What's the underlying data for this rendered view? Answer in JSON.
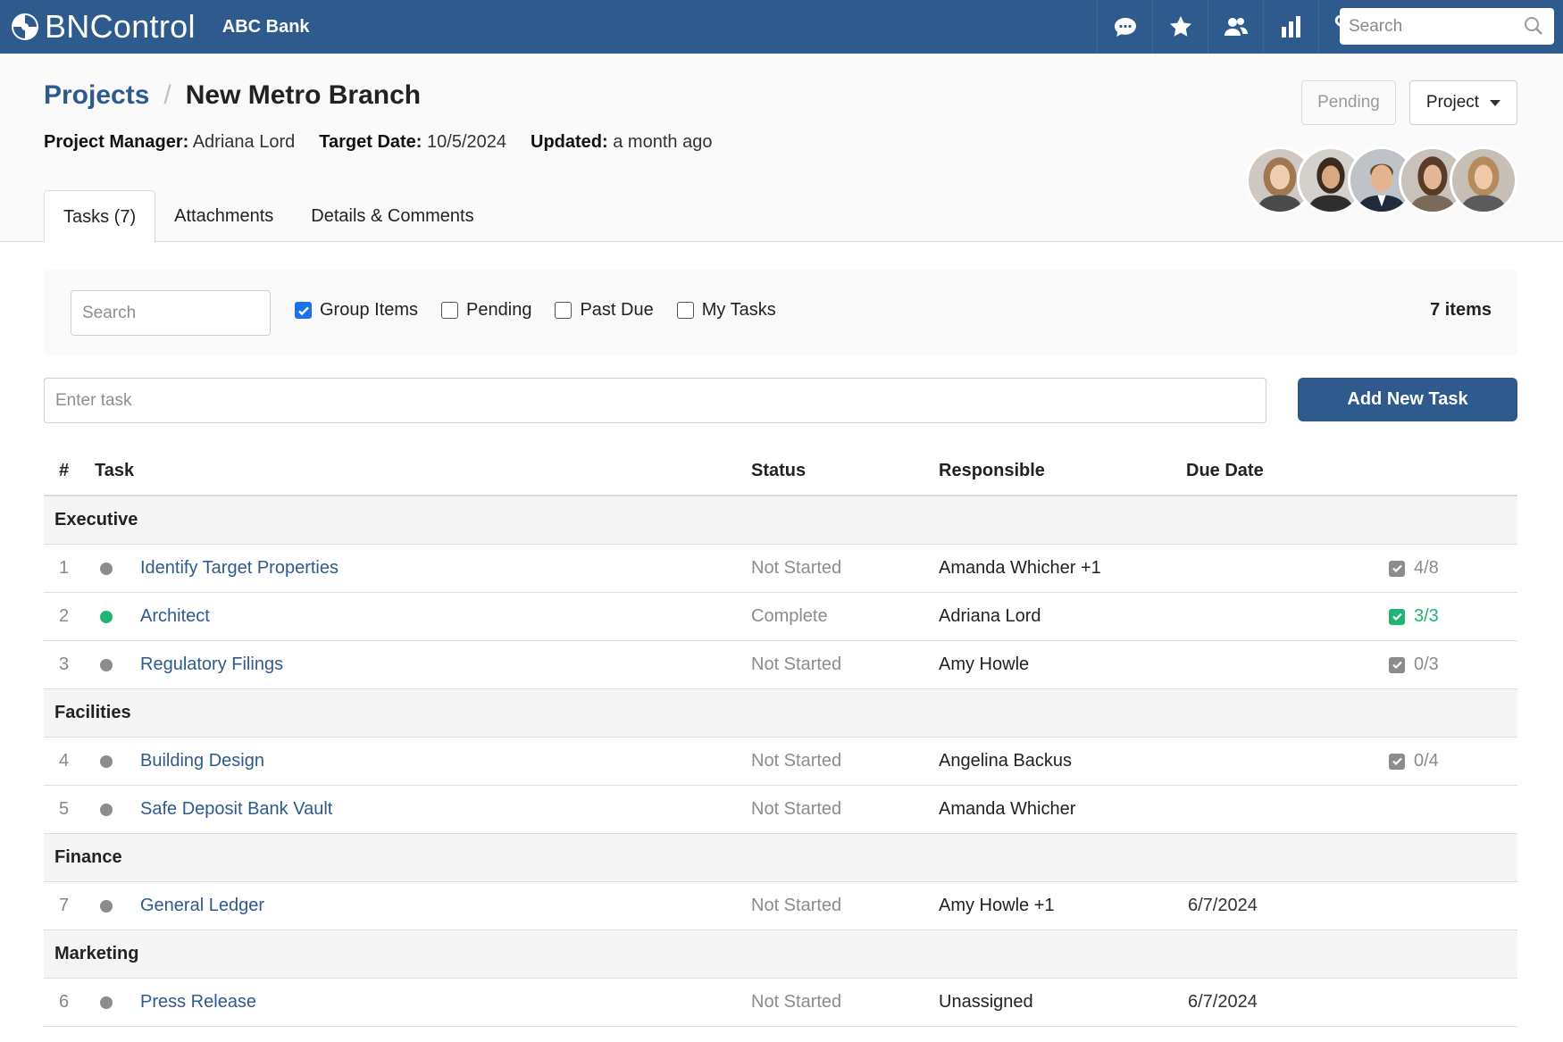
{
  "navbar": {
    "brand": "BNControl",
    "bank": "ABC Bank",
    "search_placeholder": "Search",
    "bg_color": "#2e5a8e",
    "icons": [
      "chat-icon",
      "star-icon",
      "users-icon",
      "bar-chart-icon",
      "link-icon"
    ]
  },
  "header": {
    "breadcrumb_root": "Projects",
    "breadcrumb_sep": "/",
    "title": "New Metro Branch",
    "manager_label": "Project Manager:",
    "manager_value": "Adriana Lord",
    "target_label": "Target Date:",
    "target_value": "10/5/2024",
    "updated_label": "Updated:",
    "updated_value": "a month ago",
    "pending_button": "Pending",
    "project_button": "Project"
  },
  "tabs": [
    {
      "label": "Tasks (7)",
      "active": true
    },
    {
      "label": "Attachments",
      "active": false
    },
    {
      "label": "Details & Comments",
      "active": false
    }
  ],
  "filters": {
    "search_placeholder": "Search",
    "group_items": "Group Items",
    "group_items_checked": true,
    "pending": "Pending",
    "past_due": "Past Due",
    "my_tasks": "My Tasks",
    "count": "7 items"
  },
  "new_task": {
    "placeholder": "Enter task",
    "button": "Add New Task"
  },
  "table": {
    "headers": {
      "num": "#",
      "task": "Task",
      "status": "Status",
      "responsible": "Responsible",
      "due": "Due Date"
    },
    "groups": [
      {
        "name": "Executive",
        "rows": [
          {
            "num": "1",
            "task": "Identify Target Properties",
            "status": "Not Started",
            "responsible": "Amanda Whicher +1",
            "due": "",
            "checklist": "4/8",
            "complete": false
          },
          {
            "num": "2",
            "task": "Architect",
            "status": "Complete",
            "responsible": "Adriana Lord",
            "due": "",
            "checklist": "3/3",
            "complete": true
          },
          {
            "num": "3",
            "task": "Regulatory Filings",
            "status": "Not Started",
            "responsible": "Amy Howle",
            "due": "",
            "checklist": "0/3",
            "complete": false
          }
        ]
      },
      {
        "name": "Facilities",
        "rows": [
          {
            "num": "4",
            "task": "Building Design",
            "status": "Not Started",
            "responsible": "Angelina Backus",
            "due": "",
            "checklist": "0/4",
            "complete": false
          },
          {
            "num": "5",
            "task": "Safe Deposit Bank Vault",
            "status": "Not Started",
            "responsible": "Amanda Whicher",
            "due": "",
            "checklist": "",
            "complete": false
          }
        ]
      },
      {
        "name": "Finance",
        "rows": [
          {
            "num": "7",
            "task": "General Ledger",
            "status": "Not Started",
            "responsible": "Amy Howle +1",
            "due": "6/7/2024",
            "checklist": "",
            "complete": false
          }
        ]
      },
      {
        "name": "Marketing",
        "rows": [
          {
            "num": "6",
            "task": "Press Release",
            "status": "Not Started",
            "responsible": "Unassigned",
            "due": "6/7/2024",
            "checklist": "",
            "complete": false
          }
        ]
      }
    ]
  }
}
